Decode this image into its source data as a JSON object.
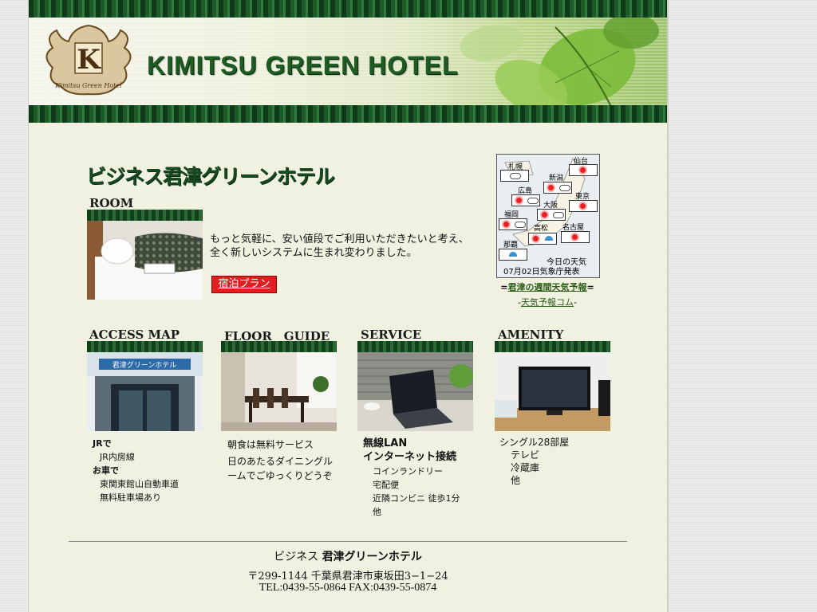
{
  "header": {
    "hotel_name": "KIMITSU GREEN HOTEL",
    "logo_letter": "K",
    "logo_text": "Kimitsu Green Hotel"
  },
  "main": {
    "jp_title": "ビジネス君津グリーンホテル",
    "room": {
      "title": "ROOM",
      "description_line1": "もっと気軽に、安い値段でご利用いただきたいと考え、",
      "description_line2": "全く新しいシステムに生まれ変わりました。",
      "plan_button": "宿泊プラン"
    },
    "weather": {
      "cities": [
        "札幌",
        "仙台",
        "新潟",
        "広島",
        "東京",
        "大阪",
        "福岡",
        "名古屋",
        "高松",
        "那覇"
      ],
      "caption_line1": "今日の天気",
      "caption_line2": "07月02日気象庁発表",
      "link1_prefix": "=",
      "link1": "君津の週間天気予報",
      "link1_suffix": "=",
      "link2_prefix": "-",
      "link2": "天気予報コム",
      "link2_suffix": "-"
    },
    "access": {
      "title": "ACCESS MAP",
      "photo_sign": "君津グリーンホテル",
      "line1": "JRで",
      "line2": "JR内房線",
      "line3": "お車で",
      "line4": "東関東館山自動車道",
      "line5": "無料駐車場あり"
    },
    "floor": {
      "title": "FLOOR　GUIDE",
      "line1": "朝食は無料サービス",
      "line2": "日のあたるダイニングル",
      "line3": "ームでごゆっくりどうぞ"
    },
    "service": {
      "title": "SERVICE",
      "headline1": "無線LAN",
      "headline2": "インターネット接続",
      "items": [
        "コインランドリー",
        "宅配便",
        "近隣コンビニ 徒歩1分",
        "他"
      ]
    },
    "amenity": {
      "title": "AMENITY",
      "line1": "シングル28部屋",
      "items": [
        "テレビ",
        "冷蔵庫",
        "他"
      ]
    }
  },
  "footer": {
    "name_prefix": "ビジネス",
    "name_bold": "君津グリーンホテル",
    "address": "〒299-1144 千葉県君津市東坂田3−1−24",
    "contact": "TEL:0439-55-0864 FAX:0439-55-0874"
  },
  "colors": {
    "accent_green": "#1e5c24",
    "plan_red": "#e02020",
    "link_green": "#2a5e15"
  }
}
